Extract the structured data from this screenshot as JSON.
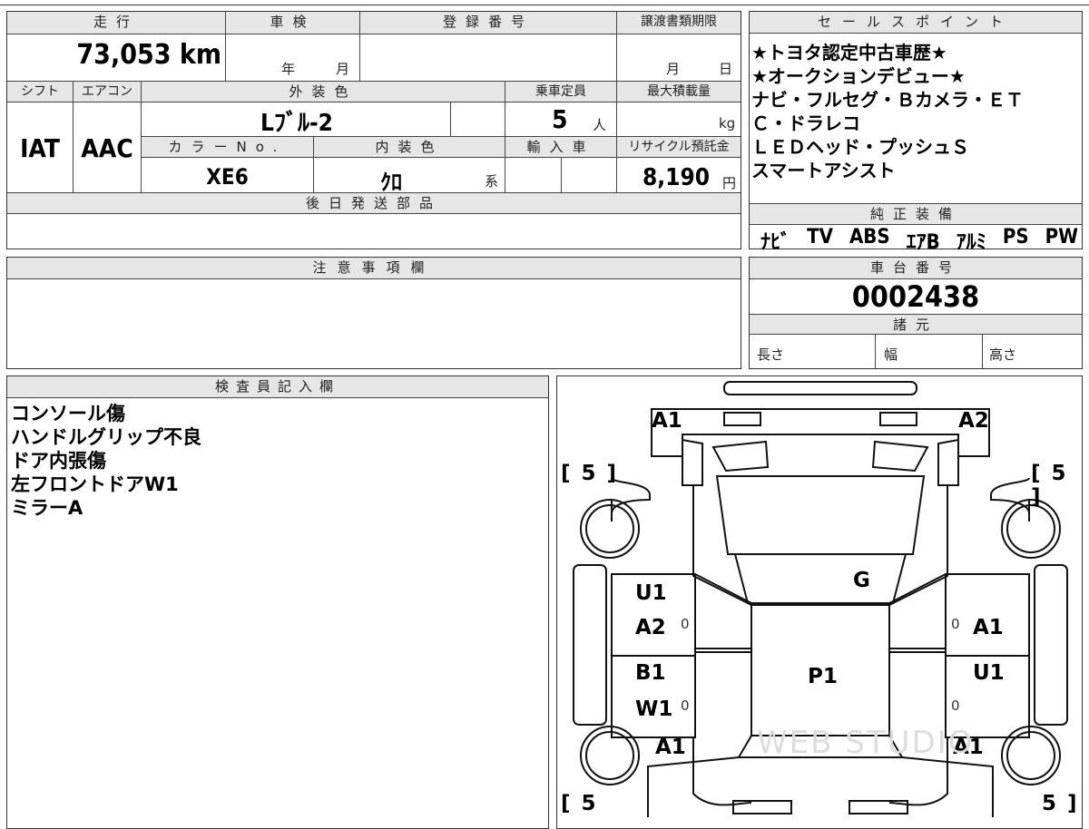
{
  "top": {
    "mileage_label": "走行",
    "mileage_value": "73,053 km",
    "inspection_label": "車検",
    "inspection_year": "年",
    "inspection_month": "月",
    "registration_label": "登録番号",
    "transfer_label": "譲渡書類期限",
    "transfer_month": "月",
    "transfer_day": "日",
    "shift_label": "シフト",
    "ac_label": "エアコン",
    "exterior_color_label": "外装色",
    "capacity_label": "乗車定員",
    "max_load_label": "最大積載量",
    "shift_value": "IAT",
    "ac_value": "AAC",
    "exterior_color_value": "Lﾌﾞﾙ-2",
    "capacity_value": "5",
    "capacity_unit": "人",
    "max_load_unit": "kg",
    "color_no_label": "カラーNo.",
    "interior_color_label": "内装色",
    "import_label": "輸入車",
    "recycle_label": "リサイクル預託金",
    "color_no_value": "XE6",
    "interior_color_value": "ｸﾛ",
    "interior_color_suffix": "系",
    "recycle_value": "8,190",
    "recycle_unit": "円",
    "later_parts_label": "後日発送部品"
  },
  "sales_points": {
    "label": "セールスポイント",
    "lines": [
      "★トヨタ認定中古車歴★",
      "★オークションデビュー★",
      "ナビ・フルセグ・Ｂカメラ・ＥＴ",
      "Ｃ・ドラレコ",
      "ＬＥＤヘッド・プッシュＳ",
      "スマートアシスト"
    ]
  },
  "genuine_equipment": {
    "label": "純正装備",
    "items": [
      "ﾅﾋﾞ",
      "TV",
      "ABS",
      "ｴｱB",
      "ｱﾙﾐ",
      "PS",
      "PW"
    ]
  },
  "notes": {
    "label": "注意事項欄"
  },
  "chassis": {
    "label": "車台番号",
    "value": "0002438",
    "specs_label": "諸元",
    "length_label": "長さ",
    "width_label": "幅",
    "height_label": "高さ"
  },
  "inspector": {
    "label": "検査員記入欄",
    "lines": [
      "コンソール傷",
      "ハンドルグリップ不良",
      "ドア内張傷",
      "左フロントドアW1",
      "ミラーA"
    ]
  },
  "diagram": {
    "front_left": "A1",
    "front_right": "A2",
    "tire_fl": "[ 5 ]",
    "tire_fr": "[ 5 ]",
    "tire_rl": "[ 5",
    "tire_rr": "5 ]",
    "windshield": "G",
    "left_front_door_1": "U1",
    "left_front_door_2": "A2",
    "left_front_door_zero": "0",
    "right_front_door_zero": "0",
    "right_front_door": "A1",
    "left_rear_door_1": "B1",
    "left_rear_door_2": "W1",
    "left_rear_door_zero": "0",
    "right_rear_door": "U1",
    "right_rear_door_zero": "0",
    "roof": "P1",
    "rear_left": "A1",
    "rear_right": "A1",
    "watermark": "WEB STUDIO"
  }
}
